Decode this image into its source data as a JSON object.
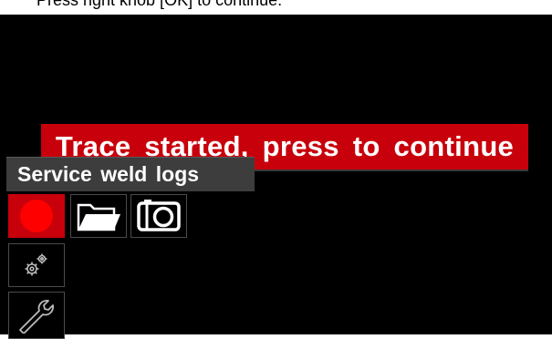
{
  "instruction": {
    "text": "Press right knob [OK] to continue."
  },
  "banner": {
    "message": "Trace started, press to continue",
    "background_color": "#c8000b",
    "text_color": "#ffffff"
  },
  "menu": {
    "title": "Service weld logs"
  },
  "toolbar": {
    "items": [
      {
        "icon": "record-icon",
        "selected": true,
        "accent_color": "#ff0000"
      },
      {
        "icon": "folder-icon",
        "selected": false
      },
      {
        "icon": "camera-icon",
        "selected": false
      }
    ]
  },
  "side_menu": {
    "items": [
      {
        "icon": "gears-icon"
      },
      {
        "icon": "wrench-icon"
      }
    ]
  },
  "colors": {
    "screen_background": "#000000",
    "title_bar": "#3d3d3d",
    "selection": "#c8000b"
  }
}
